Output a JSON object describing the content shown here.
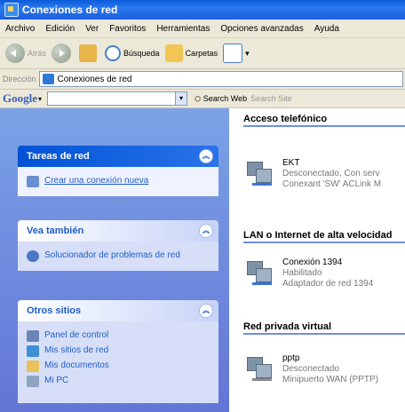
{
  "window": {
    "title": "Conexiones de red"
  },
  "menubar": [
    "Archivo",
    "Edición",
    "Ver",
    "Favoritos",
    "Herramientas",
    "Opciones avanzadas",
    "Ayuda"
  ],
  "toolbar": {
    "back": "Atrás",
    "search": "Búsqueda",
    "folders": "Carpetas"
  },
  "address": {
    "label": "Dirección",
    "value": "Conexiones de red"
  },
  "googlebar": {
    "logo": "Google",
    "dropdown": "▾",
    "search_web": "Search Web",
    "search_site": "Search Site"
  },
  "left": {
    "tasks": {
      "title": "Tareas de red",
      "items": [
        "Crear una conexión nueva"
      ]
    },
    "see_also": {
      "title": "Vea también",
      "items": [
        "Solucionador de problemas de red"
      ]
    },
    "other_places": {
      "title": "Otros sitios",
      "items": [
        "Panel de control",
        "Mis sitios de red",
        "Mis documentos",
        "Mi PC"
      ]
    }
  },
  "right": {
    "groups": [
      {
        "title": "Acceso telefónico",
        "items": [
          {
            "name": "EKT",
            "status": "Desconectado, Con serv",
            "device": "Conexant 'SW' ACLink M"
          }
        ]
      },
      {
        "title": "LAN o Internet de alta velocidad",
        "items": [
          {
            "name": "Conexión 1394",
            "status": "Habilitado",
            "device": "Adaptador de red 1394"
          }
        ]
      },
      {
        "title": "Red privada virtual",
        "items": [
          {
            "name": "pptp",
            "status": "Desconectado",
            "device": "Minipuerto WAN (PPTP)"
          }
        ]
      }
    ]
  },
  "colors": {
    "titlebar": "#0a5bd9",
    "pane": "#7ba2e7",
    "link": "#215dc6",
    "rule": "#6f8ee0"
  }
}
